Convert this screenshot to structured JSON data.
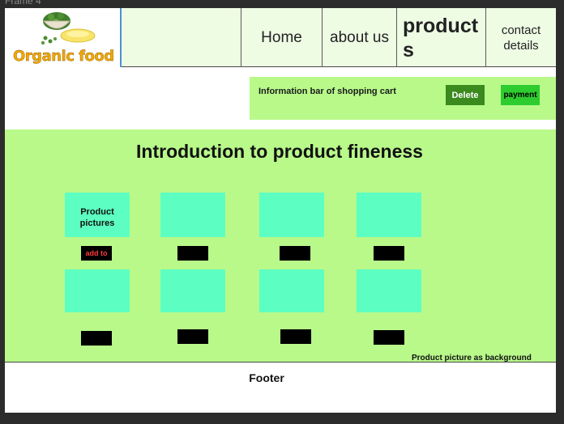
{
  "frame": {
    "label": "Frame 4"
  },
  "header": {
    "logo_text": "Organic food",
    "nav": {
      "home": "Home",
      "about": "about us",
      "products": "products",
      "contact": "contact details"
    }
  },
  "cart": {
    "title": "Information bar of shopping cart",
    "delete_label": "Delete",
    "payment_label": "payment"
  },
  "main": {
    "title": "Introduction to product fineness",
    "tile_label": "Product pictures",
    "add_to_label": "add to",
    "background_note": "Product picture as background"
  },
  "footer": {
    "text": "Footer"
  },
  "colors": {
    "accent_green": "#b8f98a",
    "tile": "#5cffc1",
    "header_bg": "#eefce4",
    "delete_btn": "#3a8a1e",
    "payment_btn": "#2ecc2e",
    "logo_text": "#f2a800"
  }
}
